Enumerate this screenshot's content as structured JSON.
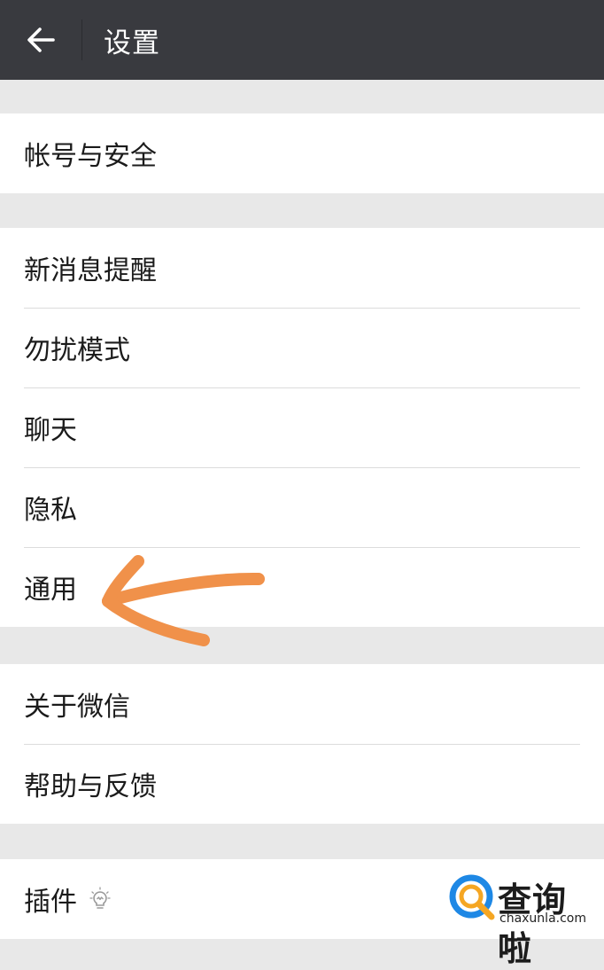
{
  "header": {
    "title": "设置",
    "back_icon": "arrow-left-icon",
    "background": "#393a3f"
  },
  "groups": [
    {
      "items": [
        {
          "label": "帐号与安全"
        }
      ]
    },
    {
      "items": [
        {
          "label": "新消息提醒"
        },
        {
          "label": "勿扰模式"
        },
        {
          "label": "聊天"
        },
        {
          "label": "隐私"
        },
        {
          "label": "通用"
        }
      ]
    },
    {
      "items": [
        {
          "label": "关于微信"
        },
        {
          "label": "帮助与反馈"
        }
      ]
    },
    {
      "items": [
        {
          "label": "插件",
          "icon": "lightbulb-icon"
        }
      ]
    }
  ],
  "annotation": {
    "type": "arrow",
    "color": "#f0914a",
    "points_to": "通用"
  },
  "watermark": {
    "name": "查询啦",
    "url": "chaxunla.com",
    "logo_colors": [
      "#1e88e5",
      "#f5a623"
    ]
  }
}
